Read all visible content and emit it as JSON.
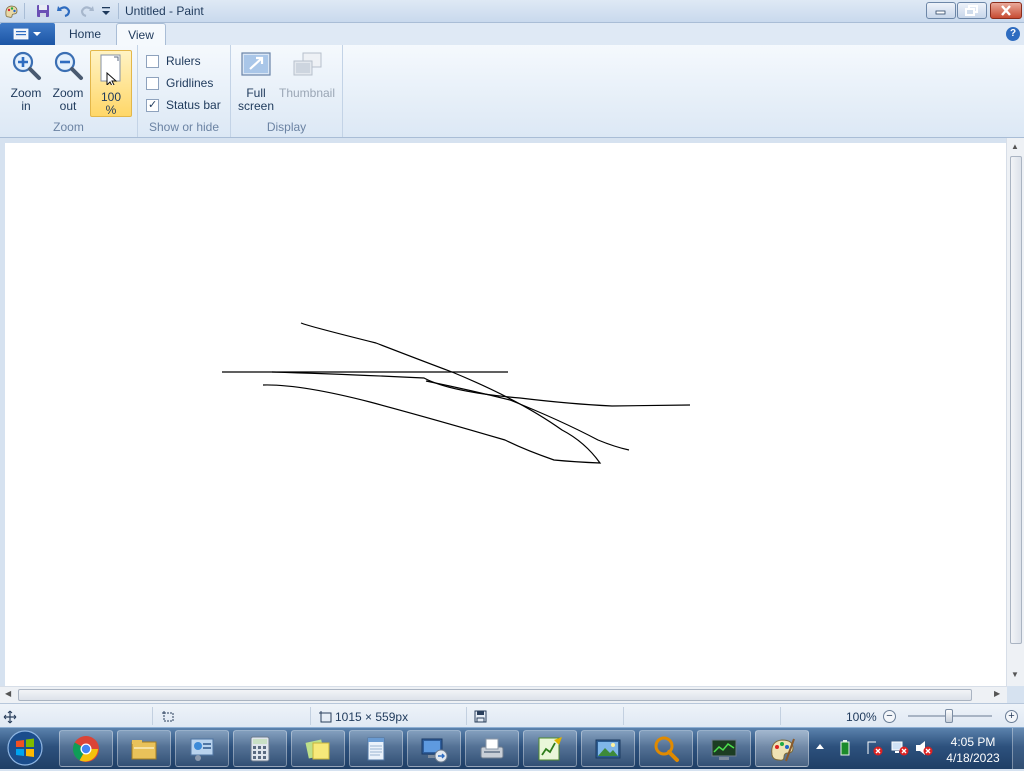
{
  "window": {
    "title": "Untitled - Paint"
  },
  "ribbon": {
    "tabs": [
      {
        "label": "Home",
        "active": false
      },
      {
        "label": "View",
        "active": true
      }
    ],
    "help_glyph": "?",
    "groups": {
      "zoom": {
        "label": "Zoom",
        "zoom_in": "Zoom\nin",
        "zoom_in_l1": "Zoom",
        "zoom_in_l2": "in",
        "zoom_out_l1": "Zoom",
        "zoom_out_l2": "out",
        "hundred_l1": "100",
        "hundred_l2": "%"
      },
      "show_hide": {
        "label": "Show or hide",
        "rulers": {
          "label": "Rulers",
          "checked": false
        },
        "gridlines": {
          "label": "Gridlines",
          "checked": false
        },
        "status_bar": {
          "label": "Status bar",
          "checked": true
        },
        "check_glyph": "✓"
      },
      "display": {
        "label": "Display",
        "full_screen_l1": "Full",
        "full_screen_l2": "screen",
        "thumbnail": "Thumbnail"
      }
    }
  },
  "status": {
    "image_size": "1015 × 559px",
    "zoom_level": "100%",
    "zoom_out_glyph": "−",
    "zoom_in_glyph": "+"
  },
  "taskbar": {
    "apps": [
      "chrome-icon",
      "file-explorer-icon",
      "control-panel-icon",
      "calculator-icon",
      "sticky-notes-icon",
      "notepad-icon",
      "remote-desktop-icon",
      "fax-scan-icon",
      "paint-chart-icon",
      "photo-viewer-icon",
      "magnifier-icon",
      "resource-monitor-icon",
      "paint-icon"
    ],
    "clock_time": "4:05 PM",
    "clock_date": "4/18/2023"
  },
  "colors": {
    "ribbon_bg": "#f5f9fd",
    "accent": "#1c55a5",
    "highlight": "#ffd768",
    "canvas": "#ffffff"
  }
}
